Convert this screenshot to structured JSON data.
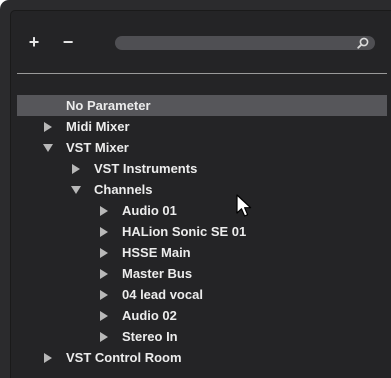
{
  "toolbar": {
    "add_label": "+",
    "remove_label": "−",
    "search_placeholder": ""
  },
  "tree": {
    "items": [
      {
        "label": "No Parameter",
        "level": 0,
        "state": "none",
        "selected": true
      },
      {
        "label": "Midi Mixer",
        "level": 0,
        "state": "collapsed"
      },
      {
        "label": "VST Mixer",
        "level": 0,
        "state": "expanded"
      },
      {
        "label": "VST Instruments",
        "level": 1,
        "state": "collapsed"
      },
      {
        "label": "Channels",
        "level": 1,
        "state": "expanded"
      },
      {
        "label": "Audio 01",
        "level": 2,
        "state": "collapsed"
      },
      {
        "label": "HALion Sonic SE 01",
        "level": 2,
        "state": "collapsed"
      },
      {
        "label": "HSSE Main",
        "level": 2,
        "state": "collapsed"
      },
      {
        "label": "Master Bus",
        "level": 2,
        "state": "collapsed"
      },
      {
        "label": "04 lead vocal",
        "level": 2,
        "state": "collapsed"
      },
      {
        "label": "Audio 02",
        "level": 2,
        "state": "collapsed"
      },
      {
        "label": "Stereo In",
        "level": 2,
        "state": "collapsed"
      },
      {
        "label": "VST Control Room",
        "level": 0,
        "state": "collapsed"
      }
    ]
  },
  "colors": {
    "panel_bg": "#242426",
    "selection_bg": "#56565a",
    "text": "#ececec",
    "arrow": "#b8b8b8"
  }
}
